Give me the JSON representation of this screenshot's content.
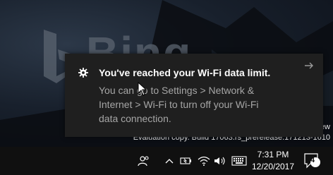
{
  "wallpaper": {
    "logo_text": "Bing"
  },
  "watermark": {
    "edition_fragment": "ew",
    "build_text": "Evaluation copy. Build 17063.rs_prerelease.171213-1610"
  },
  "toast": {
    "icon": "gear-icon",
    "title": "You've reached your Wi-Fi data limit.",
    "body_lines": [
      "You can go to Settings > Network &",
      "Internet > Wi-Fi to turn off your Wi-Fi",
      "data connection."
    ],
    "dismiss_icon": "arrow-right-icon"
  },
  "taskbar": {
    "tray_icons": [
      "people-icon",
      "chevron-up-icon",
      "battery-icon",
      "wifi-icon",
      "volume-icon",
      "keyboard-icon"
    ],
    "clock": {
      "time": "7:31 PM",
      "date": "12/20/2017"
    },
    "notifications": {
      "icon": "action-center-icon",
      "count": "4"
    }
  },
  "colors": {
    "toast_background": "#1f1f1f",
    "toast_title": "#ffffff",
    "toast_body": "#a6a6a6",
    "taskbar_background": "#101010"
  }
}
